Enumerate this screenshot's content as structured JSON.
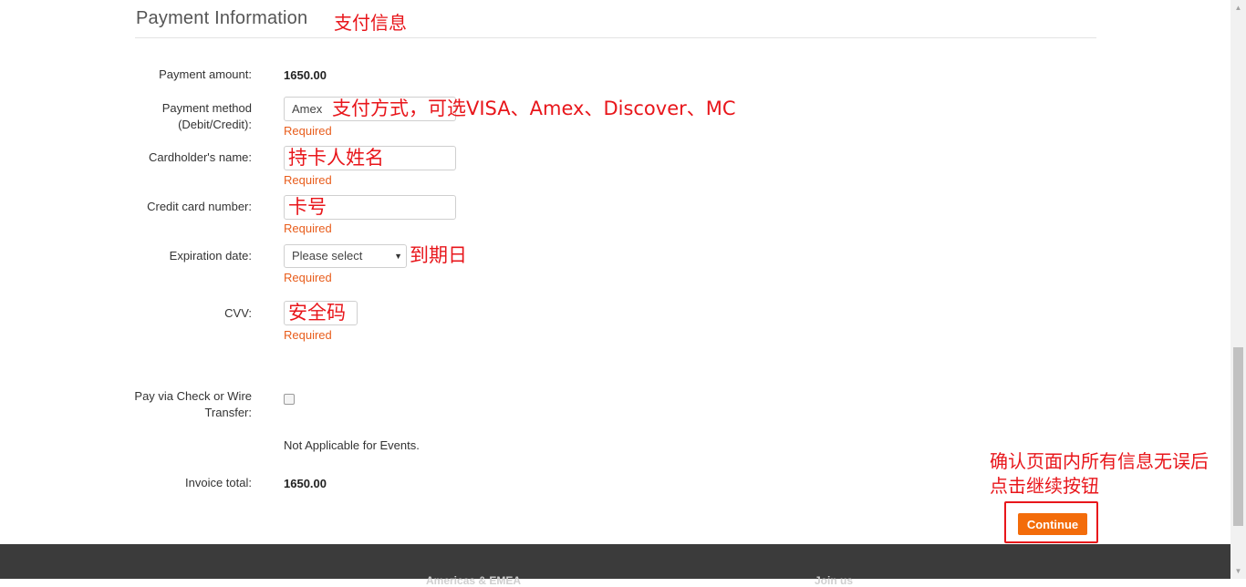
{
  "section": {
    "title": "Payment Information",
    "annotation": "支付信息"
  },
  "fields": {
    "payment_amount": {
      "label": "Payment amount:",
      "value": "1650.00"
    },
    "payment_method": {
      "label_line1": "Payment method",
      "label_line2": "(Debit/Credit):",
      "selected": "Amex",
      "required": "Required",
      "annotation": "支付方式，可选VISA、Amex、Discover、MC"
    },
    "cardholder_name": {
      "label": "Cardholder's name:",
      "value": "持卡人姓名",
      "required": "Required"
    },
    "card_number": {
      "label": "Credit card number:",
      "value": "卡号",
      "required": "Required"
    },
    "expiration": {
      "label": "Expiration date:",
      "selected": "Please select",
      "required": "Required",
      "annotation": "到期日"
    },
    "cvv": {
      "label": "CVV:",
      "value": "安全码",
      "required": "Required"
    },
    "check_wire": {
      "label_line1": "Pay via Check or Wire",
      "label_line2": "Transfer:",
      "checked": false,
      "note": "Not Applicable for Events."
    },
    "invoice_total": {
      "label": "Invoice total:",
      "value": "1650.00"
    }
  },
  "actions": {
    "continue_label": "Continue",
    "annotation_line1": "确认页面内所有信息无误后",
    "annotation_line2": "点击继续按钮"
  },
  "footer": {
    "col1": "Americas & EMEA",
    "col2": "Join us"
  },
  "colors": {
    "accent": "#f36c0a",
    "required": "#e85d1c",
    "annotation": "#e8161b",
    "footer": "#3b3b3b"
  }
}
